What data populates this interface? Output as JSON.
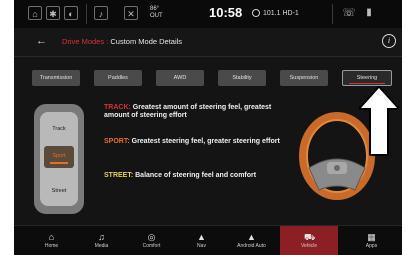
{
  "status": {
    "icon_seat": "seat-icon",
    "icon_fan": "fan-icon",
    "icon_temp": "thermometer-icon",
    "icon_bell": "bell-icon",
    "icon_mute": "mute-icon",
    "outside_temp_value": "86°",
    "outside_temp_label": "OUT",
    "time": "10:58",
    "radio": "101.1 HD-1",
    "icon_phone": "phone-icon",
    "icon_signal": "signal-icon"
  },
  "header": {
    "back_label": "←",
    "crumb_root": "Drive Modes :",
    "crumb_page": "Custom Mode Details",
    "info_label": "i"
  },
  "tabs": [
    {
      "label": "Transmission"
    },
    {
      "label": "Paddles"
    },
    {
      "label": "AWD"
    },
    {
      "label": "Stability"
    },
    {
      "label": "Suspension"
    },
    {
      "label": "Steering",
      "active": true
    }
  ],
  "selector": {
    "top": "Track",
    "middle": "Sport",
    "bottom": "Street"
  },
  "descriptions": {
    "track_key": "TRACK:",
    "track_text": "Greatest amount of steering feel, greatest amount of steering effort",
    "sport_key": "SPORT:",
    "sport_text": "Greatest steering feel, greater steering effort",
    "street_key": "STREET:",
    "street_text": "Balance of steering feel and comfort"
  },
  "nav": [
    {
      "label": "Home",
      "icon": "home-icon"
    },
    {
      "label": "Media",
      "icon": "music-icon"
    },
    {
      "label": "Comfort",
      "icon": "comfort-icon"
    },
    {
      "label": "Nav",
      "icon": "nav-arrow-icon"
    },
    {
      "label": "Android Auto",
      "icon": "android-auto-icon"
    },
    {
      "label": "Vehicle",
      "icon": "car-icon",
      "active": true
    },
    {
      "label": "Apps",
      "icon": "apps-grid-icon"
    }
  ],
  "colors": {
    "accent_red": "#d8323a",
    "sport_orange": "#e2712a",
    "street_yellow": "#e8d14a",
    "active_nav": "#8c1f24"
  }
}
